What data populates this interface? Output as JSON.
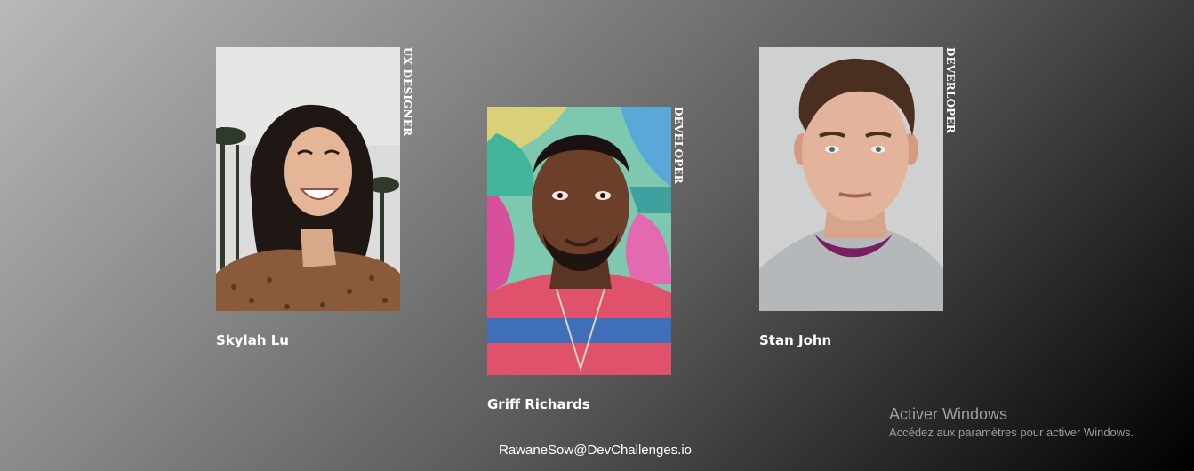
{
  "team": [
    {
      "name": "Skylah Lu",
      "role": "UX DESIGNER",
      "photo": "portrait-photo"
    },
    {
      "name": "Griff Richards",
      "role": "DEVELOPER",
      "photo": "portrait-photo"
    },
    {
      "name": "Stan John",
      "role": "DEVERLOPER",
      "photo": "portrait-photo"
    }
  ],
  "footer": {
    "credit": "RawaneSow@DevChallenges.io"
  },
  "os_watermark": {
    "title": "Activer Windows",
    "subtitle": "Accédez aux paramètres pour activer Windows."
  },
  "colors": {
    "text": "#ffffff",
    "background_start": "#b9b9b9",
    "background_end": "#000000",
    "watermark": "#9d9d9d"
  }
}
